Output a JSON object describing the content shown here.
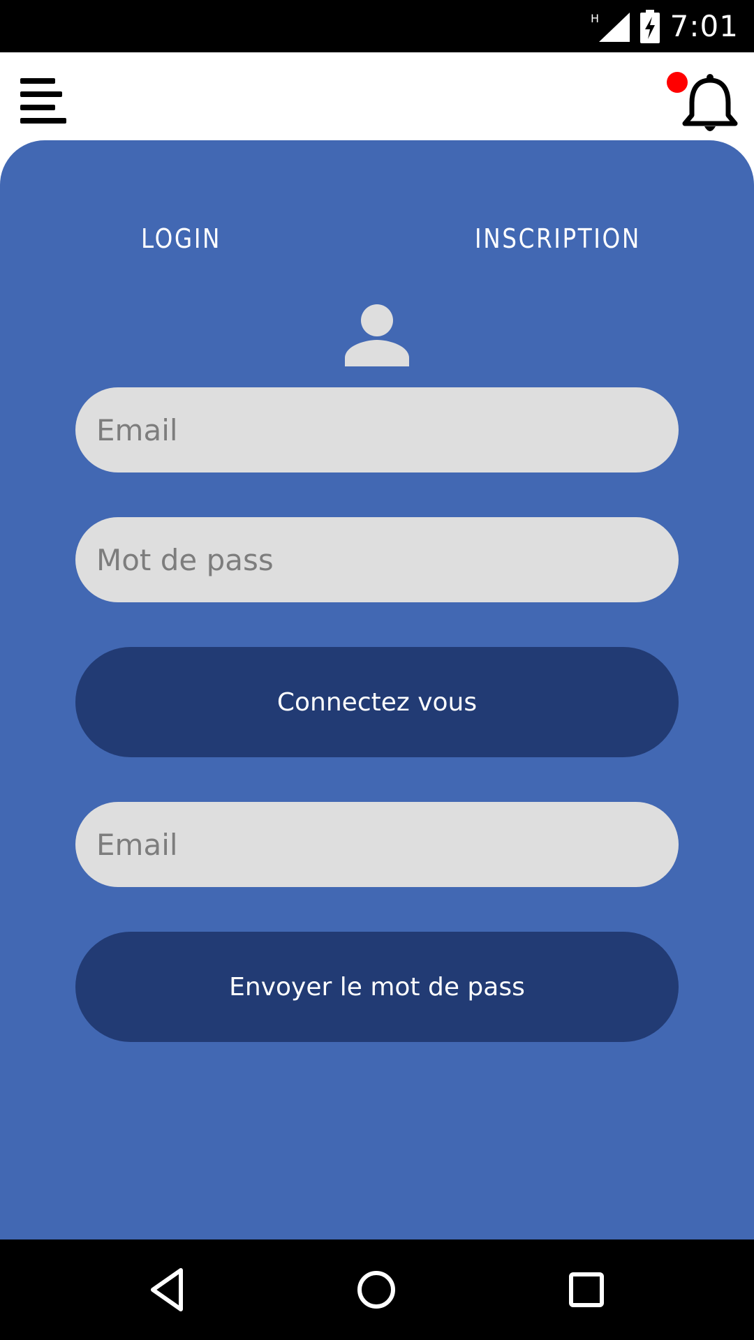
{
  "status_bar": {
    "time": "7:01",
    "network_type": "H",
    "icons": [
      "signal-icon",
      "battery-charging-icon"
    ]
  },
  "app_bar": {
    "menu_icon": "menu-icon",
    "notification_icon": "bell-icon",
    "has_unread_notification": true
  },
  "tabs": {
    "login": "LOGIN",
    "inscription": "INSCRIPTION"
  },
  "login_form": {
    "avatar_icon": "user-icon",
    "email_placeholder": "Email",
    "password_placeholder": "Mot de pass",
    "submit_label": "Connectez vous"
  },
  "reset_form": {
    "email_placeholder": "Email",
    "submit_label": "Envoyer le mot de pass"
  },
  "colors": {
    "panel_background": "#4268b3",
    "button_background": "#223b74",
    "field_background": "#dedede",
    "notification_dot": "#ff0000"
  },
  "nav_bar": {
    "buttons": [
      "back-icon",
      "home-icon",
      "recent-apps-icon"
    ]
  }
}
